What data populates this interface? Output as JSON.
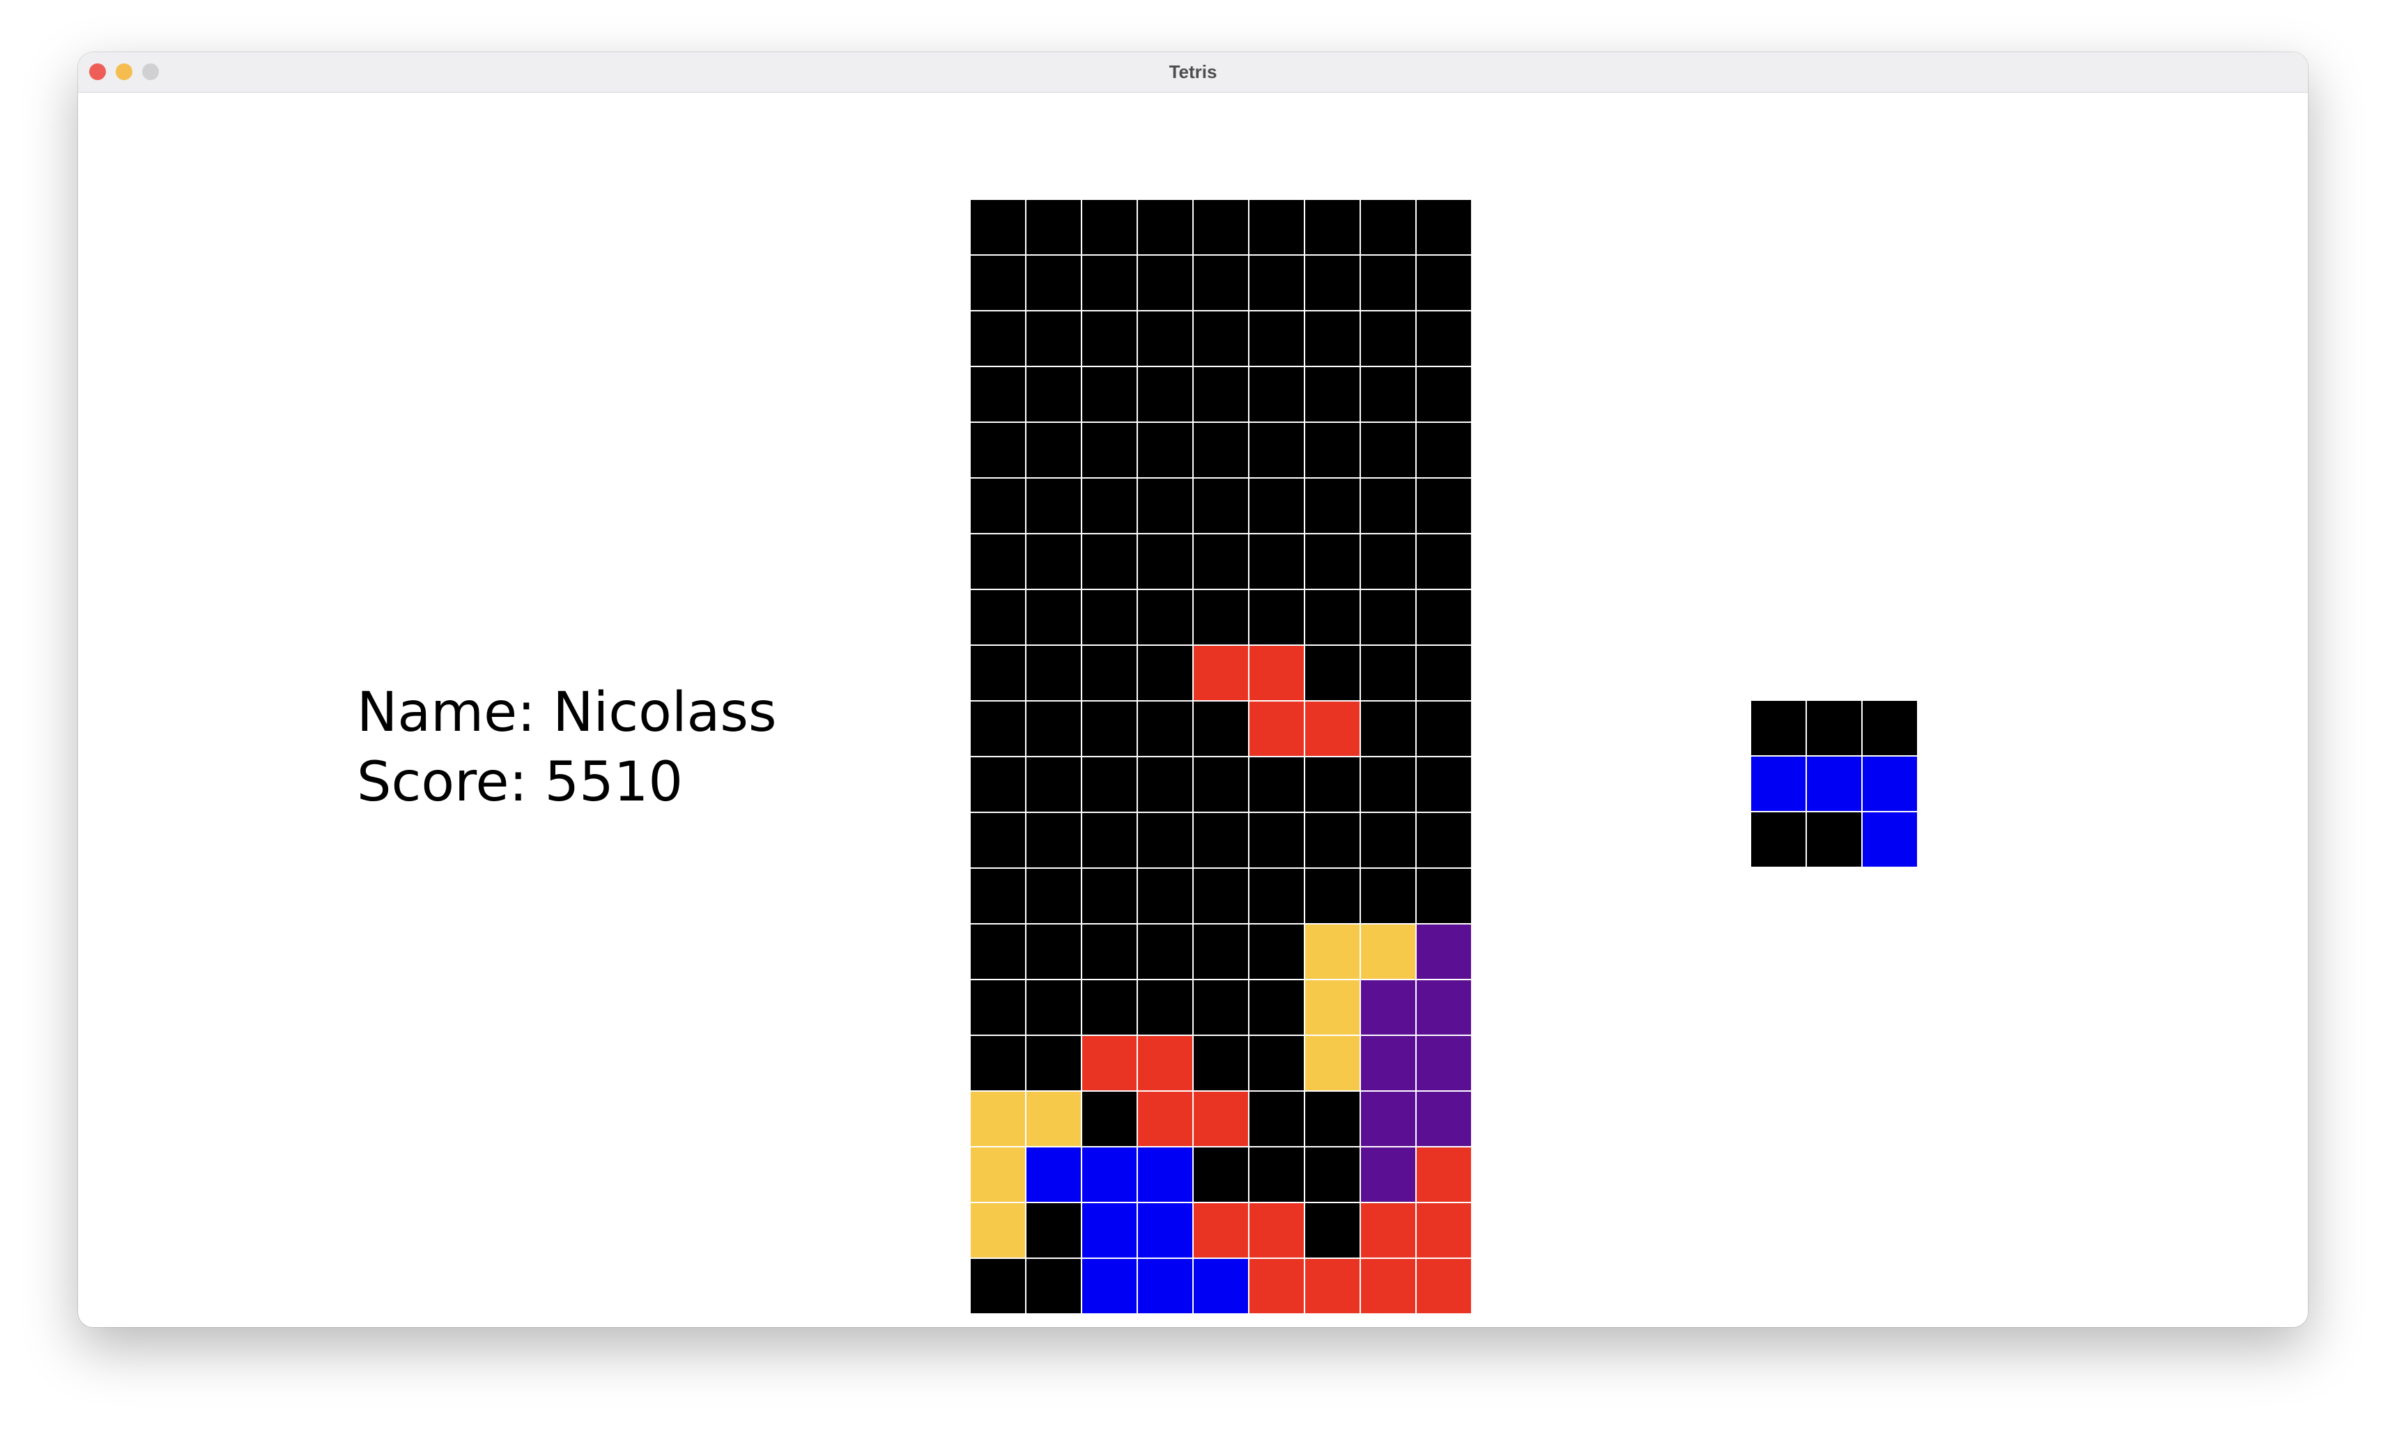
{
  "window": {
    "title": "Tetris",
    "traffic_lights": {
      "close_color": "#ee5e56",
      "minimize_color": "#f5bd4f",
      "zoom_color": "#d0d0d2"
    }
  },
  "player": {
    "name_line": "Name: Nicolass",
    "score_line": "Score: 5510"
  },
  "colors": {
    "K": "#000000",
    "R": "#e93323",
    "Y": "#f6c94b",
    "P": "#5b1093",
    "B": "#0000f5"
  },
  "board": {
    "columns": 9,
    "rows": [
      "KKKKKKKKK",
      "KKKKKKKKK",
      "KKKKKKKKK",
      "KKKKKKKKK",
      "KKKKKKKKK",
      "KKKKKKKKK",
      "KKKKKKKKK",
      "KKKKKKKKK",
      "KKKKRRKKK",
      "KKKKKRRKK",
      "KKKKKKKKK",
      "KKKKKKKKK",
      "KKKKKKKKK",
      "KKKKKKYYP",
      "KKKKKKYPP",
      "KKRRKKYPP",
      "YYKRRKKPP",
      "YBBBKKKPR",
      "YKBBRRKRR",
      "KKBBBRRRR"
    ]
  },
  "next_piece": {
    "rows": [
      "KKK",
      "BBB",
      "KKB"
    ]
  }
}
